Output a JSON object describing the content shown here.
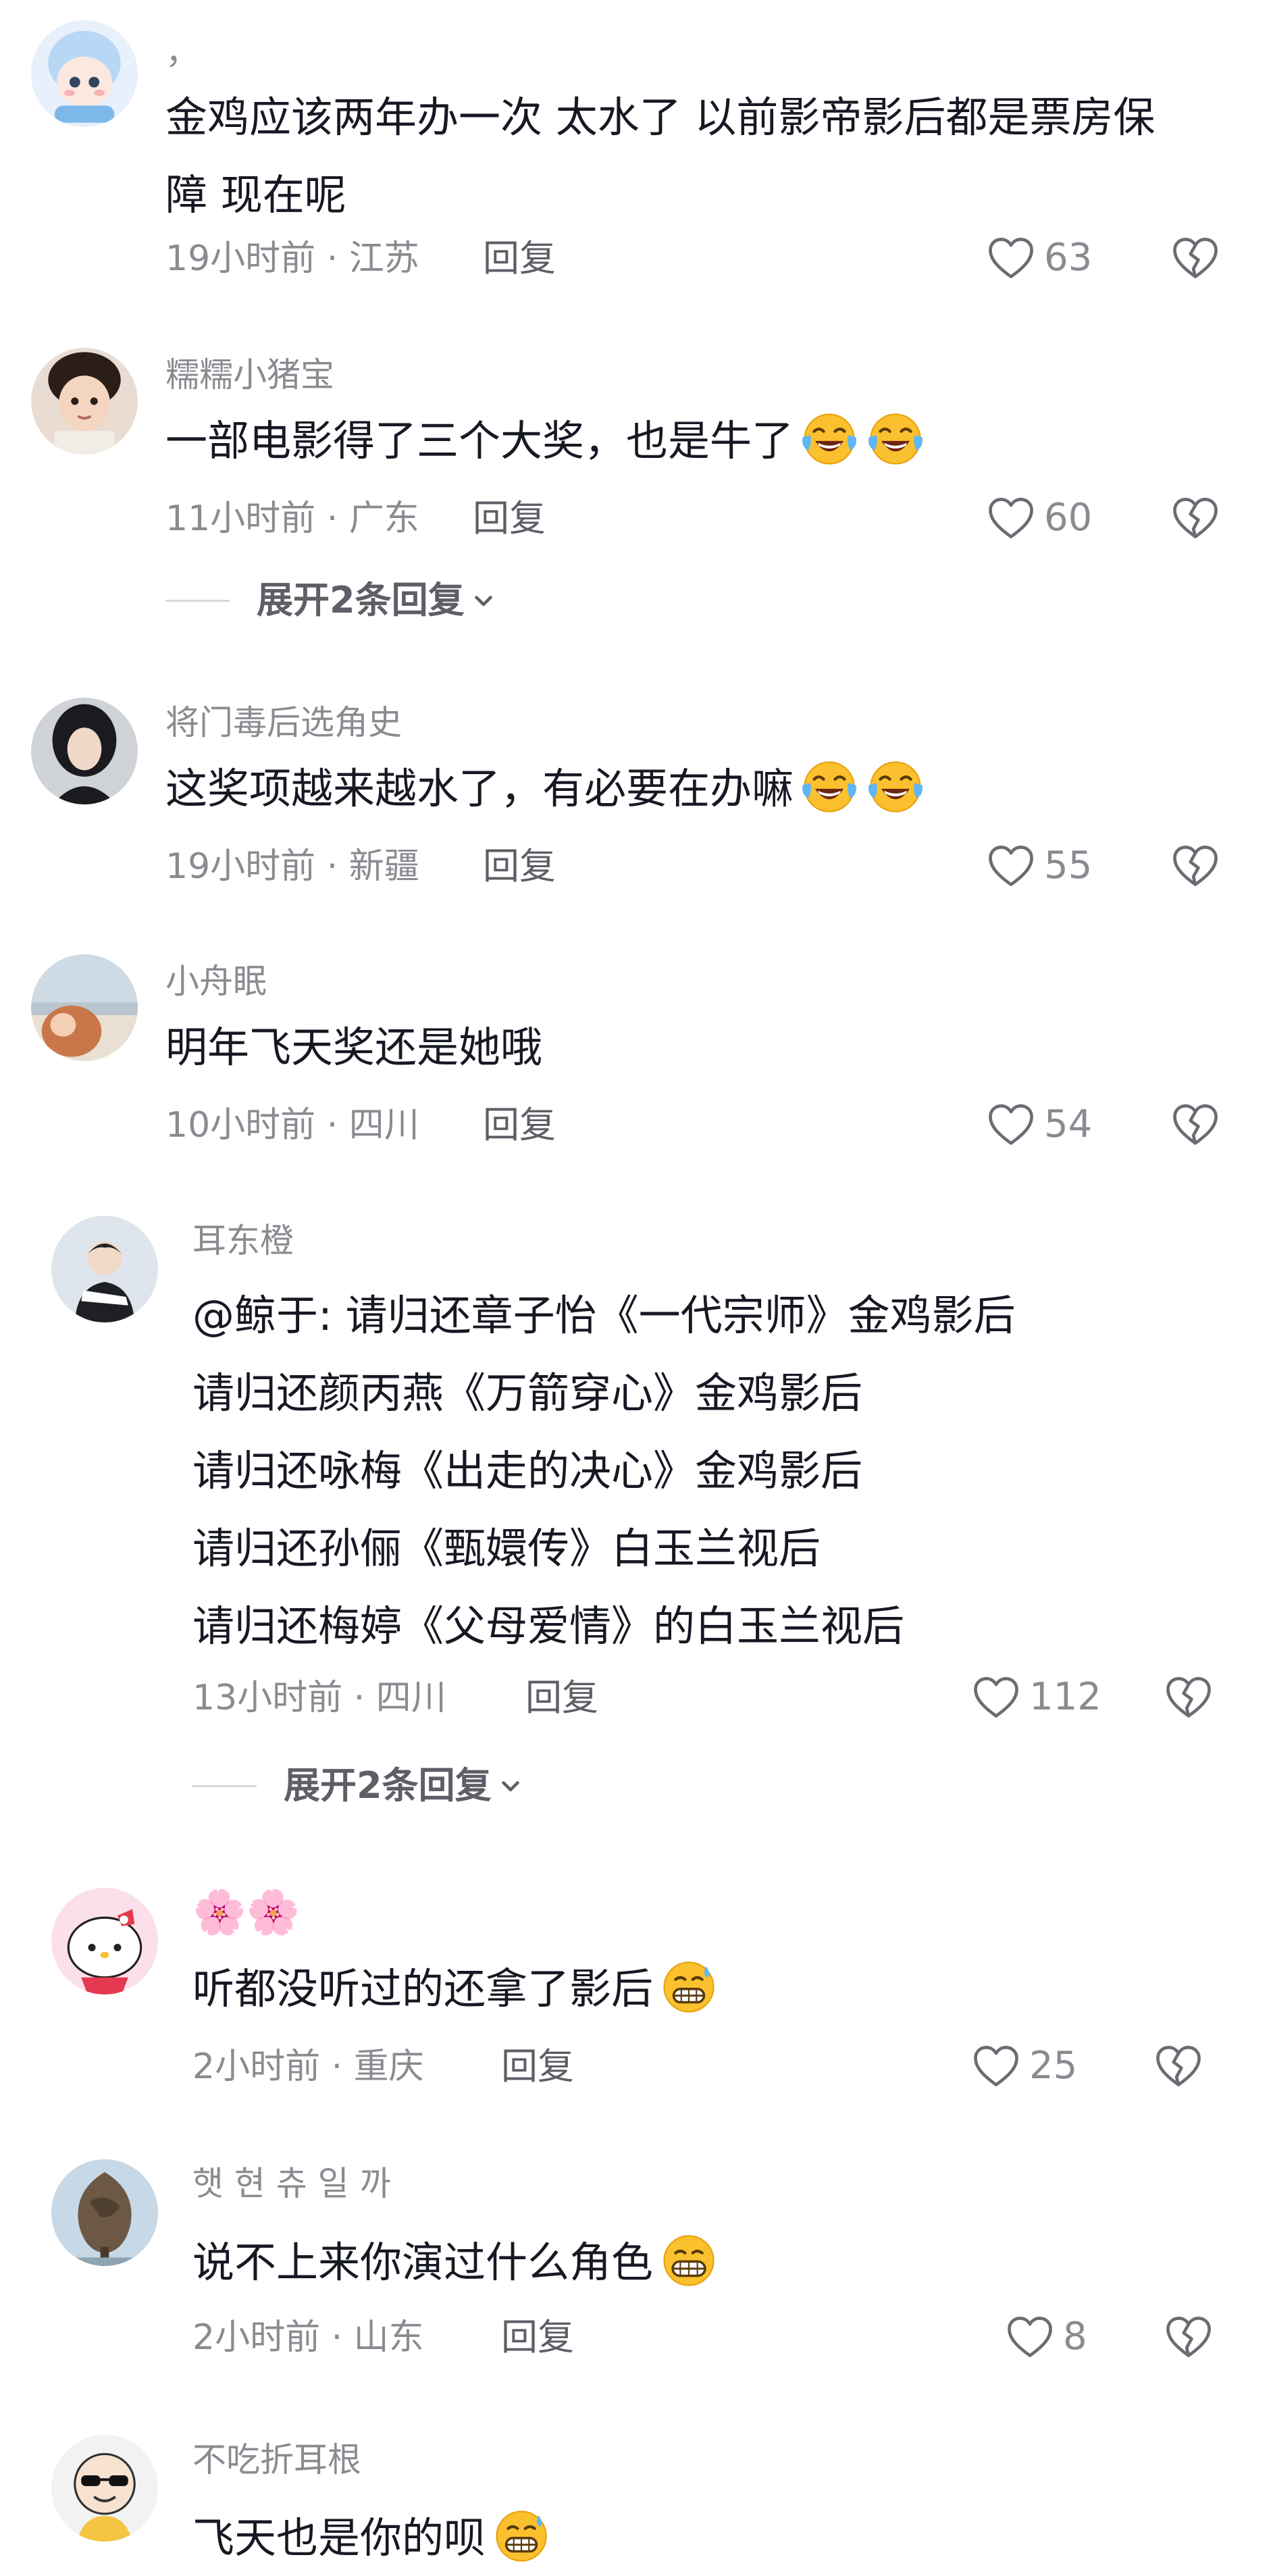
{
  "comments": [
    {
      "username": "，",
      "lines": [
        "金鸡应该两年办一次 太水了 以前影帝影后都是票房保",
        "障 现在呢"
      ],
      "time": "19小时前 · 江苏",
      "reply": "回复",
      "likes": "63"
    },
    {
      "username": "糯糯小猪宝",
      "lines": [
        "一部电影得了三个大奖，也是牛了"
      ],
      "emoji": [
        "laugh-cry-icon",
        "laugh-cry-icon"
      ],
      "time": "11小时前 · 广东",
      "reply": "回复",
      "likes": "60",
      "expand": "展开2条回复"
    },
    {
      "username": "将门毒后选角史",
      "lines": [
        "这奖项越来越水了，有必要在办嘛"
      ],
      "emoji": [
        "laugh-cry-icon",
        "laugh-cry-icon"
      ],
      "time": "19小时前 · 新疆",
      "reply": "回复",
      "likes": "55"
    },
    {
      "username": "小舟眠",
      "lines": [
        "明年飞天奖还是她哦"
      ],
      "time": "10小时前 · 四川",
      "reply": "回复",
      "likes": "54"
    },
    {
      "username": "耳东橙",
      "lines": [
        "@鲸于: 请归还章子怡《一代宗师》金鸡影后",
        "请归还颜丙燕《万箭穿心》金鸡影后",
        "请归还咏梅《出走的决心》金鸡影后",
        "请归还孙俪《甄嬛传》白玉兰视后",
        "请归还梅婷《父母爱情》的白玉兰视后"
      ],
      "time": "13小时前 · 四川",
      "reply": "回复",
      "likes": "112",
      "expand": "展开2条回复"
    },
    {
      "username": "🌸🌸",
      "lines": [
        "听都没听过的还拿了影后"
      ],
      "emoji": [
        "grin-sweat-icon"
      ],
      "time": "2小时前 · 重庆",
      "reply": "回复",
      "likes": "25"
    },
    {
      "username": "햇 현 츄 일 까",
      "lines": [
        "说不上来你演过什么角色"
      ],
      "emoji": [
        "grin-icon"
      ],
      "time": "2小时前 · 山东",
      "reply": "回复",
      "likes": "8"
    },
    {
      "username": "不吃折耳根",
      "lines": [
        "飞天也是你的呗"
      ],
      "emoji": [
        "grin-sweat-icon"
      ]
    }
  ],
  "colors": {
    "text": "#161823",
    "meta": "#8a8b91",
    "accent": "#5d5e66"
  }
}
